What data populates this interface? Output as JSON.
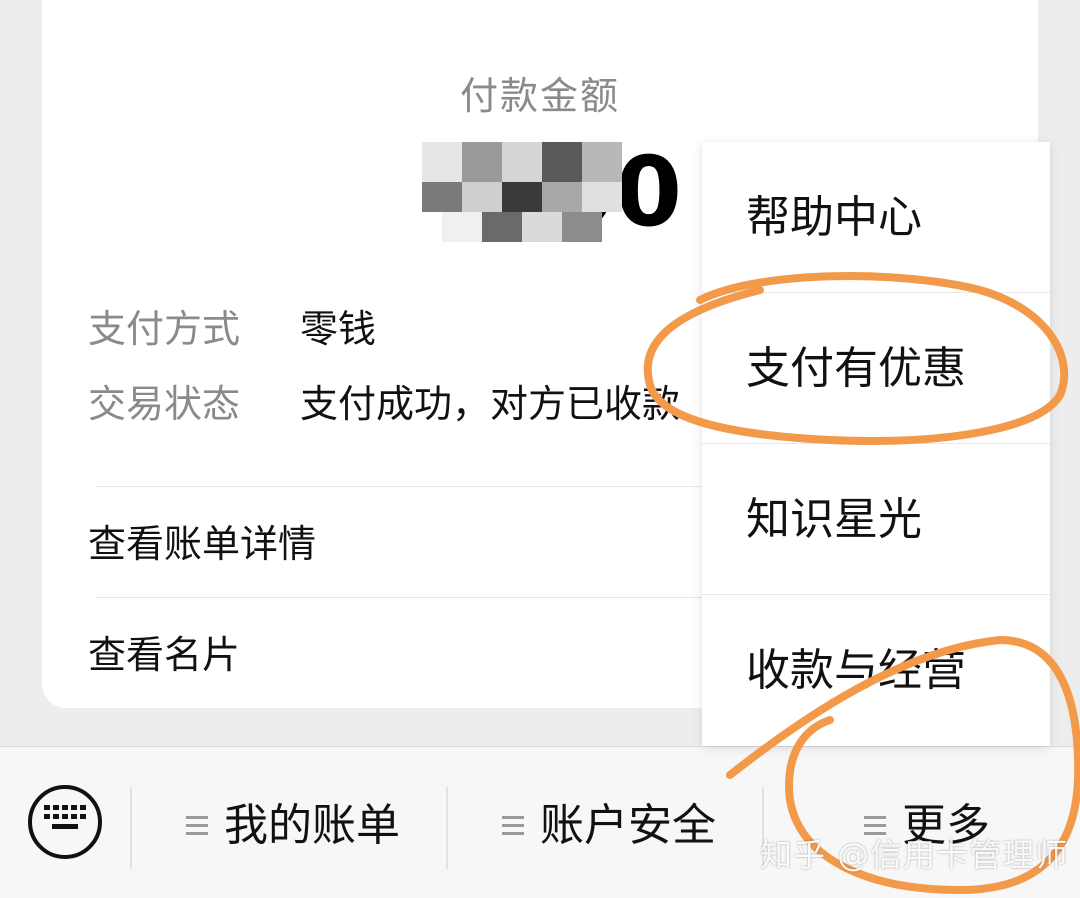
{
  "card": {
    "amount_label": "付款金额",
    "amount_visible": "00",
    "info": [
      {
        "key": "支付方式",
        "value": "零钱"
      },
      {
        "key": "交易状态",
        "value": "支付成功，对方已收款"
      }
    ],
    "links": [
      {
        "label": "查看账单详情"
      },
      {
        "label": "查看名片"
      }
    ]
  },
  "menubar": {
    "items": [
      {
        "label": "我的账单"
      },
      {
        "label": "账户安全"
      },
      {
        "label": "更多"
      }
    ]
  },
  "popup": {
    "items": [
      {
        "label": "帮助中心"
      },
      {
        "label": "支付有优惠"
      },
      {
        "label": "知识星光"
      },
      {
        "label": "收款与经营"
      }
    ]
  },
  "watermark": "知乎 @信用卡管理师",
  "colors": {
    "background": "#ededed",
    "card": "#ffffff",
    "muted_text": "#8a8a8a",
    "annotation": "#f39a4a"
  },
  "icons": {
    "keyboard": "keyboard-icon",
    "menu": "menu-lines-icon"
  }
}
